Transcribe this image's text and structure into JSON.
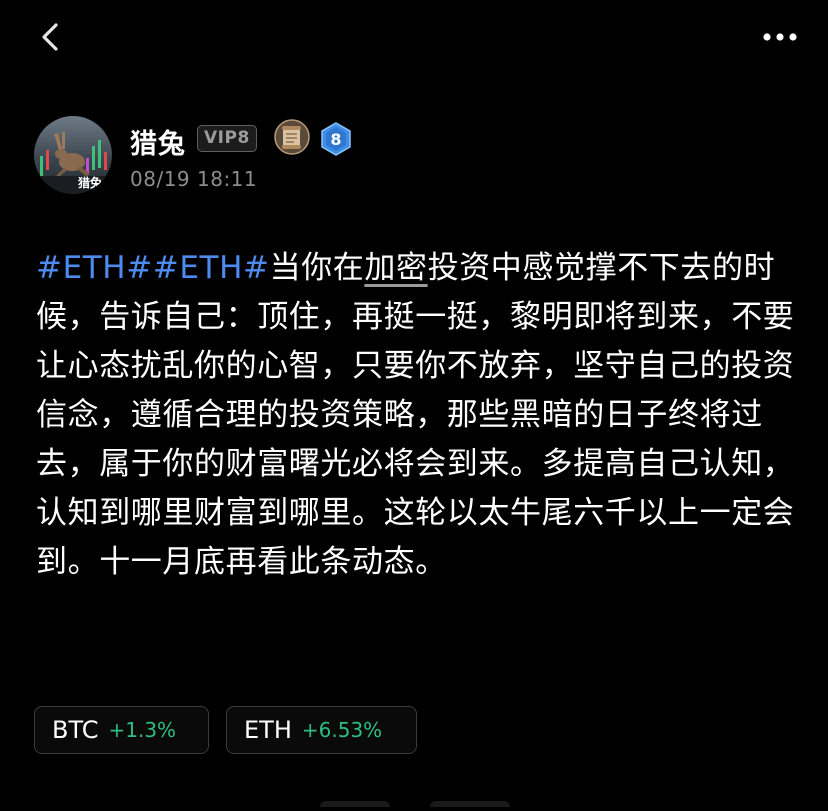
{
  "nav": {
    "back_icon": "chevron-left-icon",
    "more_icon": "more-horizontal-icon"
  },
  "author": {
    "name": "猎兔",
    "vip_label": "VIP8",
    "level_number": "8",
    "post_time": "08/19 18:11",
    "avatar_caption": "猎兔",
    "avatar_icon": "rabbit-avatar",
    "scroll_badge_icon": "scroll-badge-icon",
    "level_badge_icon": "level-hexagon-icon"
  },
  "post": {
    "hashtag_1": "#ETH#",
    "hashtag_2": "#ETH#",
    "text_before_link": "当你在",
    "linked_word": "加密",
    "text_after_link": "投资中感觉撑不下去的时候，告诉自己：顶住，再挺一挺，黎明即将到来，不要让心态扰乱你的心智，只要你不放弃，坚守自己的投资信念，遵循合理的投资策略，那些黑暗的日子终将过去，属于你的财富曙光必将会到来。多提高自己认知，认知到哪里财富到哪里。这轮以太牛尾六千以上一定会到。十一月底再看此条动态。"
  },
  "tickers": [
    {
      "symbol": "BTC",
      "change": "+1.3%"
    },
    {
      "symbol": "ETH",
      "change": "+6.53%"
    }
  ],
  "colors": {
    "background": "#000000",
    "hashtag": "#4d8bf0",
    "positive_change": "#2ebd85",
    "timestamp": "#8c8c8c",
    "level_badge": "#3d8fe6"
  }
}
